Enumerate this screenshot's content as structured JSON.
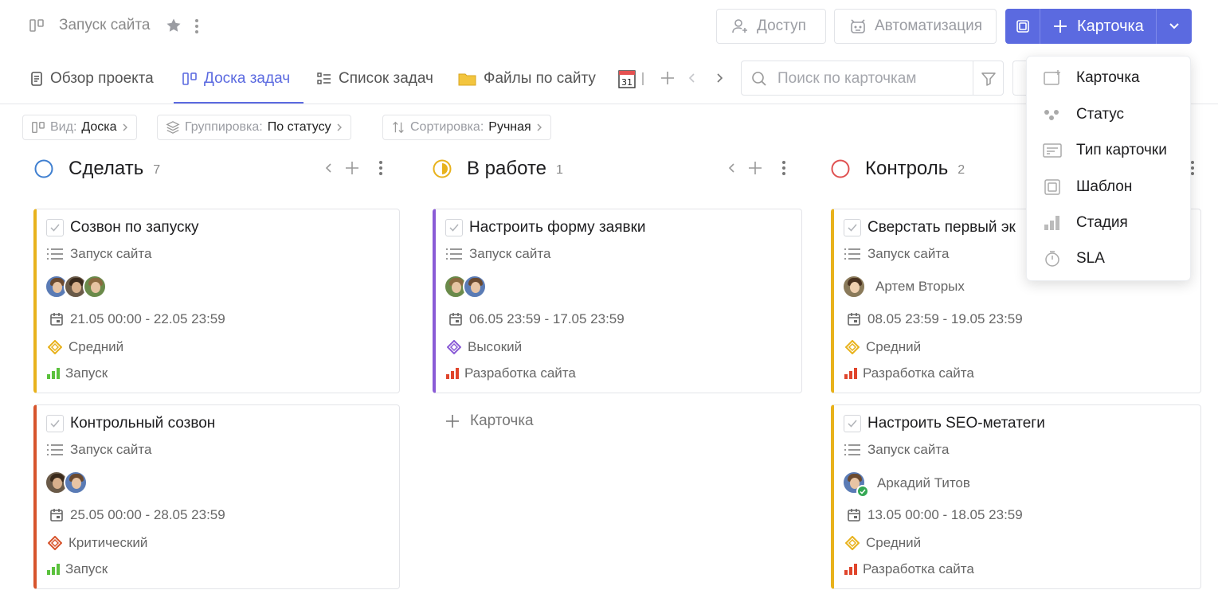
{
  "header": {
    "project_title": "Запуск сайта",
    "access_label": "Доступ",
    "automation_label": "Автоматизация",
    "card_button_label": "Карточка"
  },
  "tabs": [
    {
      "label": "Обзор проекта",
      "icon": "document-icon"
    },
    {
      "label": "Доска задач",
      "icon": "board-icon",
      "active": true
    },
    {
      "label": "Список задач",
      "icon": "list-icon"
    },
    {
      "label": "Файлы по сайту",
      "icon": "folder-icon"
    },
    {
      "label": "",
      "icon": "calendar-icon"
    }
  ],
  "search": {
    "placeholder": "Поиск по карточкам"
  },
  "chips": [
    {
      "key": "Вид:",
      "value": "Доска"
    },
    {
      "key": "Группировка:",
      "value": "По статусу"
    },
    {
      "key": "Сортировка:",
      "value": "Ручная"
    }
  ],
  "columns": [
    {
      "title": "Сделать",
      "count": "7",
      "color": "#3f7fd0",
      "cards": [
        {
          "title": "Созвон по запуску",
          "project": "Запуск сайта",
          "dates": "21.05 00:00 - 22.05 23:59",
          "priority": "Средний",
          "priority_color": "#e8b21c",
          "stage": "Запуск",
          "stage_color": "#5ac13c",
          "accent": "#e8b21c"
        },
        {
          "title": "Контрольный созвон",
          "project": "Запуск сайта",
          "dates": "25.05 00:00 - 28.05 23:59",
          "priority": "Критический",
          "priority_color": "#d7542c",
          "stage": "Запуск",
          "stage_color": "#5ac13c",
          "accent": "#d7542c"
        }
      ]
    },
    {
      "title": "В работе",
      "count": "1",
      "color": "#e8b21c",
      "cards": [
        {
          "title": "Настроить форму заявки",
          "project": "Запуск сайта",
          "dates": "06.05 23:59 - 17.05 23:59",
          "priority": "Высокий",
          "priority_color": "#8a5bd6",
          "stage": "Разработка сайта",
          "stage_color": "#e0452c",
          "accent": "#8a5bd6"
        }
      ],
      "add_label": "Карточка"
    },
    {
      "title": "Контроль",
      "count": "2",
      "color": "#e05252",
      "cards": [
        {
          "title": "Сверстать первый эк",
          "project": "Запуск сайта",
          "person": "Артем Вторых",
          "dates": "08.05 23:59 - 19.05 23:59",
          "priority": "Средний",
          "priority_color": "#e8b21c",
          "stage": "Разработка сайта",
          "stage_color": "#e0452c",
          "accent": "#e8b21c"
        },
        {
          "title": "Настроить SEO-метатеги",
          "project": "Запуск сайта",
          "person": "Аркадий Титов",
          "dates": "13.05 00:00 - 18.05 23:59",
          "priority": "Средний",
          "priority_color": "#e8b21c",
          "stage": "Разработка сайта",
          "stage_color": "#e0452c",
          "accent": "#e8b21c"
        }
      ]
    }
  ],
  "dropdown": {
    "items": [
      {
        "label": "Карточка",
        "icon": "card-add-icon"
      },
      {
        "label": "Статус",
        "icon": "status-dots-icon"
      },
      {
        "label": "Тип карточки",
        "icon": "card-type-icon"
      },
      {
        "label": "Шаблон",
        "icon": "template-icon"
      },
      {
        "label": "Стадия",
        "icon": "stage-bars-icon"
      },
      {
        "label": "SLA",
        "icon": "stopwatch-icon"
      }
    ]
  }
}
